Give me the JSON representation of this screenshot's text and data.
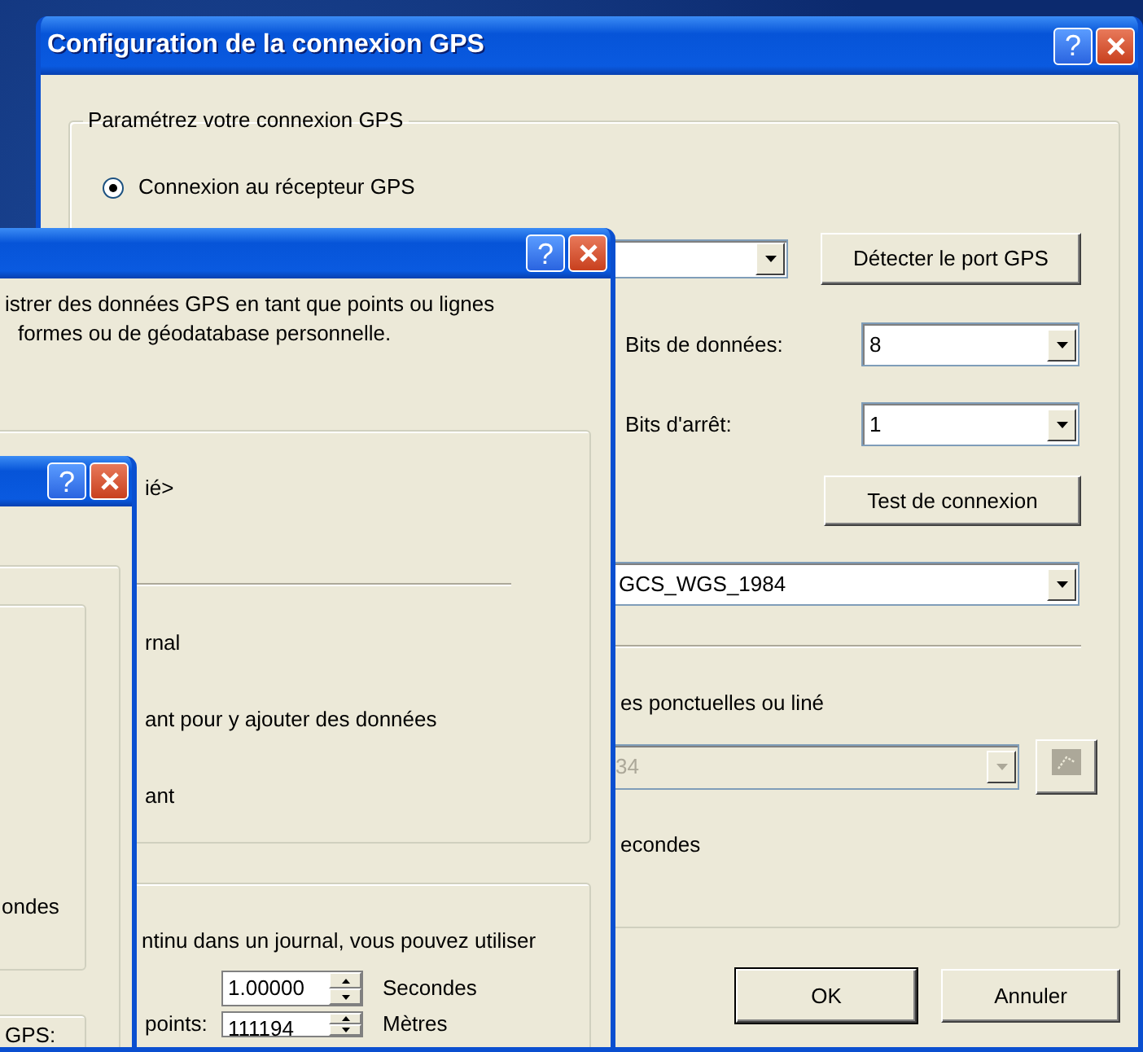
{
  "config_dialog": {
    "title": "Configuration de la connexion GPS",
    "help_button": "?",
    "group_title": "Paramétrez votre connexion GPS",
    "radio": {
      "label": "Connexion au récepteur GPS",
      "selected": true
    },
    "detect_button": "Détecter le port GPS",
    "data_bits": {
      "label": "Bits de données:",
      "value": "8"
    },
    "stop_bits": {
      "label": "Bits d'arrêt:",
      "value": "1"
    },
    "test_button": "Test de connexion",
    "coordinate_system": "GCS_WGS_1984",
    "feature_label": "es ponctuelles ou liné",
    "feature_combo": {
      "value": "34",
      "disabled": true
    },
    "feature_button": {
      "disabled": true
    },
    "seconds_label": "econdes",
    "buttons": [
      {
        "label": "OK",
        "default": true
      },
      {
        "label": "Annuler",
        "default": false
      }
    ]
  },
  "log_dialog": {
    "help_button": "?",
    "description": [
      "istrer des données GPS en tant que points ou lignes",
      "formes ou de géodatabase personnelle."
    ],
    "output_label": "ié>",
    "options": [
      "rnal",
      "ant pour y ajouter des données",
      "ant"
    ],
    "interval_note": "ntinu dans un journal, vous pouvez utiliser",
    "time_interval": {
      "value": "1.00000",
      "unit": "Secondes"
    },
    "distance": {
      "label": "points:",
      "value": "111194",
      "unit": "Mètres"
    }
  },
  "back_dialog": {
    "help_button": "?",
    "texts": [
      "ondes",
      "GPS:"
    ]
  }
}
